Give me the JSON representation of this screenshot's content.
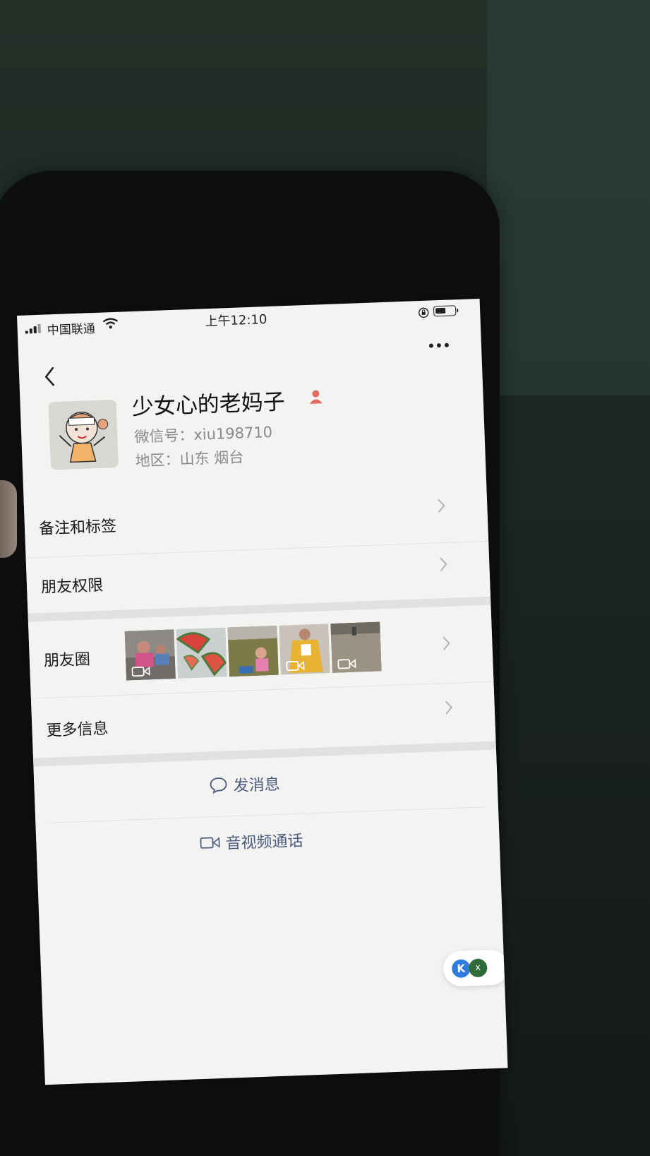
{
  "status_bar": {
    "carrier": "中国联通",
    "time": "上午12:10"
  },
  "profile": {
    "nickname": "少女心的老妈子",
    "wechat_id": "微信号：xiu198710",
    "region": "地区：山东 烟台"
  },
  "rows": {
    "remarks_tags": "备注和标签",
    "friend_permissions": "朋友权限",
    "moments": "朋友圈",
    "more_info": "更多信息"
  },
  "actions": {
    "send_message": "发消息",
    "video_call": "音视频通话"
  },
  "widget": {
    "k_label": "K",
    "close_label": "x"
  },
  "colors": {
    "screen_background": "#f3f3f1",
    "action_text": "#4b5a7f",
    "gender_icon": "#e36b5f",
    "widget_blue": "#2f7be0",
    "widget_green": "#2f6a3b"
  },
  "icons": {
    "back": "chevron-left-icon",
    "more": "more-dots-icon",
    "gender": "female-person-icon",
    "message": "chat-bubble-icon",
    "video": "video-camera-icon"
  }
}
